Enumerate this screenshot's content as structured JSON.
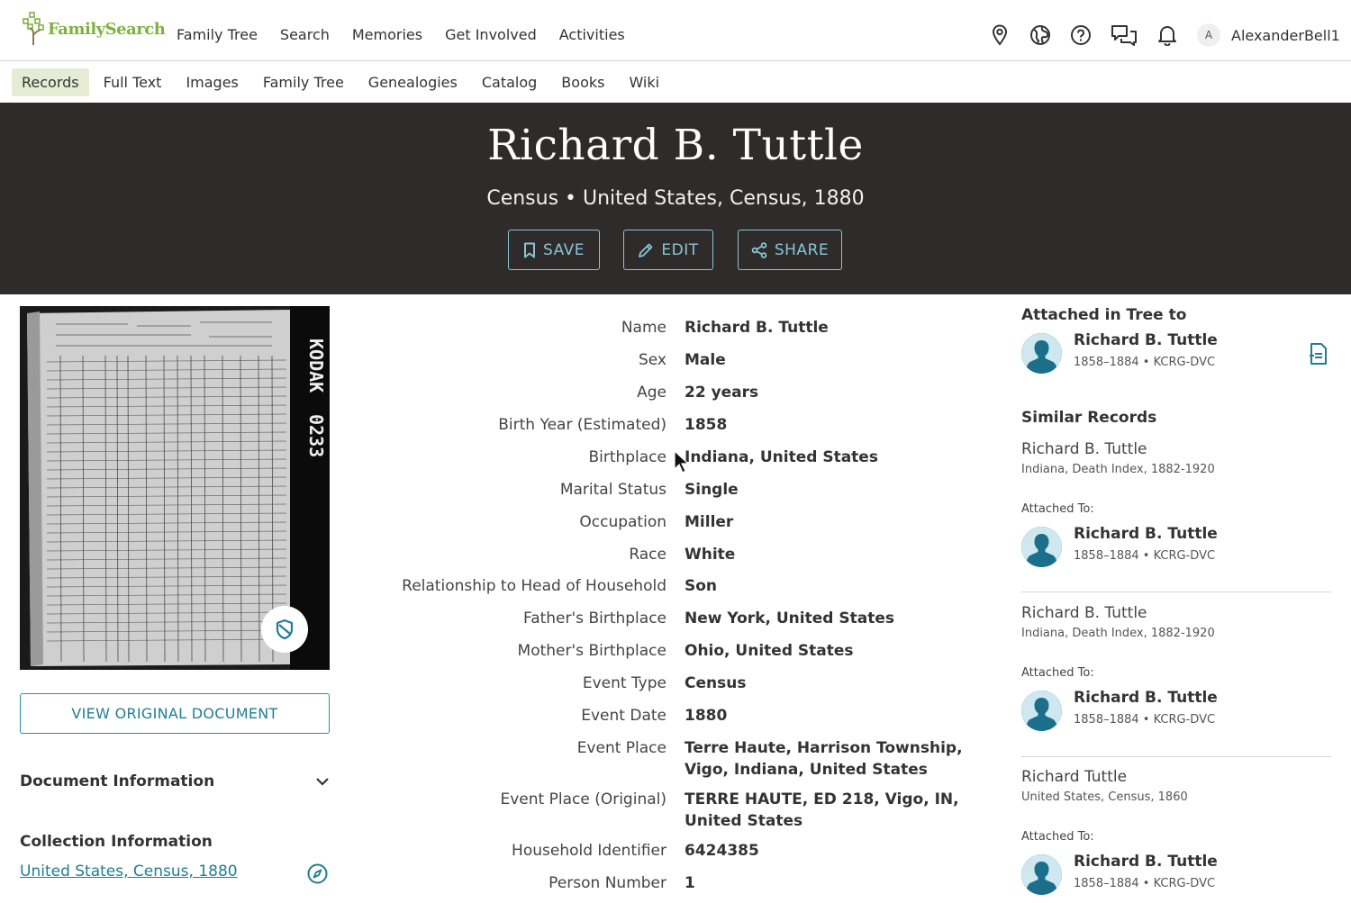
{
  "brand": {
    "name": "FamilySearch",
    "accent": "#7fb041",
    "link": "#1f7d94"
  },
  "topnav": {
    "links": [
      "Family Tree",
      "Search",
      "Memories",
      "Get Involved",
      "Activities"
    ],
    "icons": [
      "location-pin-icon",
      "globe-icon",
      "help-icon",
      "messages-icon",
      "bell-icon"
    ],
    "avatar_letter": "A",
    "username": "AlexanderBell1"
  },
  "subnav": {
    "items": [
      "Records",
      "Full Text",
      "Images",
      "Family Tree",
      "Genealogies",
      "Catalog",
      "Books",
      "Wiki"
    ],
    "active": "Records"
  },
  "hero": {
    "title": "Richard B. Tuttle",
    "subtitle": "Census • United States, Census, 1880",
    "buttons": {
      "save": "SAVE",
      "edit": "EDIT",
      "share": "SHARE"
    }
  },
  "left": {
    "thumb_label": "0233",
    "view_button": "VIEW ORIGINAL DOCUMENT",
    "document_info": "Document Information",
    "collection_info": "Collection Information",
    "collection_link": "United States, Census, 1880"
  },
  "facts": [
    {
      "label": "Name",
      "value": "Richard B. Tuttle"
    },
    {
      "label": "Sex",
      "value": "Male"
    },
    {
      "label": "Age",
      "value": "22 years"
    },
    {
      "label": "Birth Year (Estimated)",
      "value": "1858"
    },
    {
      "label": "Birthplace",
      "value": "Indiana, United States"
    },
    {
      "label": "Marital Status",
      "value": "Single"
    },
    {
      "label": "Occupation",
      "value": "Miller"
    },
    {
      "label": "Race",
      "value": "White"
    },
    {
      "label": "Relationship to Head of Household",
      "value": "Son"
    },
    {
      "label": "Father's Birthplace",
      "value": "New York, United States"
    },
    {
      "label": "Mother's Birthplace",
      "value": "Ohio, United States"
    },
    {
      "label": "Event Type",
      "value": "Census"
    },
    {
      "label": "Event Date",
      "value": "1880"
    },
    {
      "label": "Event Place",
      "value": "Terre Haute, Harrison Township, Vigo, Indiana, United States"
    },
    {
      "label": "Event Place (Original)",
      "value": "TERRE HAUTE, ED 218, Vigo, IN, United States"
    },
    {
      "label": "Household Identifier",
      "value": "6424385"
    },
    {
      "label": "Person Number",
      "value": "1"
    }
  ],
  "right": {
    "attached_heading": "Attached in Tree to",
    "attached_person": {
      "name": "Richard B. Tuttle",
      "details": "1858–1884 • KCRG-DVC"
    },
    "similar_heading": "Similar Records",
    "attached_to_label": "Attached To:",
    "similar": [
      {
        "name": "Richard B. Tuttle",
        "source": "Indiana, Death Index, 1882-1920",
        "person": {
          "name": "Richard B. Tuttle",
          "details": "1858–1884 • KCRG-DVC"
        }
      },
      {
        "name": "Richard B. Tuttle",
        "source": "Indiana, Death Index, 1882-1920",
        "person": {
          "name": "Richard B. Tuttle",
          "details": "1858–1884 • KCRG-DVC"
        }
      },
      {
        "name": "Richard Tuttle",
        "source": "United States, Census, 1860",
        "person": {
          "name": "Richard B. Tuttle",
          "details": "1858–1884 • KCRG-DVC"
        }
      }
    ]
  }
}
